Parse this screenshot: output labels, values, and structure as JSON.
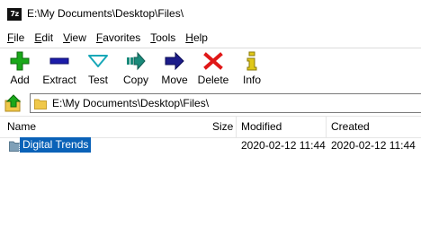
{
  "window": {
    "app_icon_text": "7z",
    "title": "E:\\My Documents\\Desktop\\Files\\"
  },
  "menu": [
    {
      "key": "F",
      "rest": "ile"
    },
    {
      "key": "E",
      "rest": "dit"
    },
    {
      "key": "V",
      "rest": "iew"
    },
    {
      "key": "F",
      "rest": "avorites"
    },
    {
      "key": "T",
      "rest": "ools"
    },
    {
      "key": "H",
      "rest": "elp"
    }
  ],
  "toolbar": {
    "add": "Add",
    "extract": "Extract",
    "test": "Test",
    "copy": "Copy",
    "move": "Move",
    "delete": "Delete",
    "info": "Info",
    "colors": {
      "add": "#1aa81a",
      "extract": "#1c1caa",
      "test": "#18a8b8",
      "copy": "#1a8a7a",
      "move": "#1c1c8a",
      "delete": "#e01818",
      "info": "#e0c818"
    }
  },
  "address": {
    "path": "E:\\My Documents\\Desktop\\Files\\"
  },
  "columns": {
    "name": "Name",
    "size": "Size",
    "modified": "Modified",
    "created": "Created"
  },
  "files": [
    {
      "name": "Digital Trends",
      "size": "",
      "modified": "2020-02-12 11:44",
      "created": "2020-02-12 11:44",
      "selected": true
    }
  ],
  "colors": {
    "selection": "#0a62b8",
    "folder": "#f0c84a"
  }
}
